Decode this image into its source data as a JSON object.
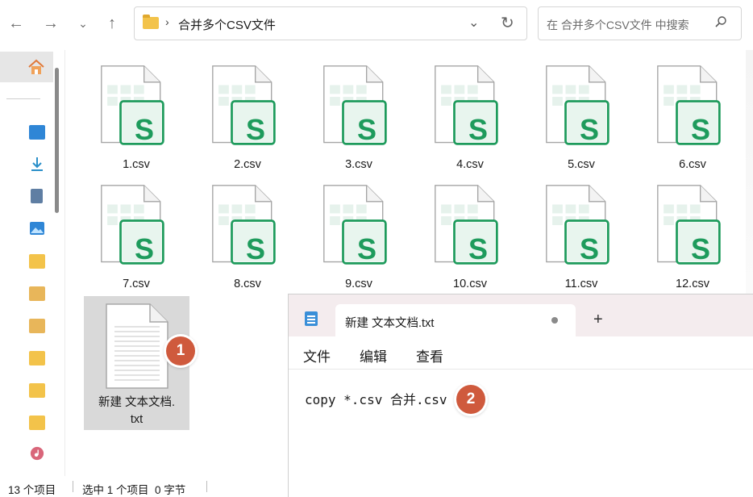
{
  "address": {
    "path": "合并多个CSV文件"
  },
  "search": {
    "placeholder": "在 合并多个CSV文件 中搜索"
  },
  "files": [
    {
      "name": "1.csv"
    },
    {
      "name": "2.csv"
    },
    {
      "name": "3.csv"
    },
    {
      "name": "4.csv"
    },
    {
      "name": "5.csv"
    },
    {
      "name": "6.csv"
    },
    {
      "name": "7.csv"
    },
    {
      "name": "8.csv"
    },
    {
      "name": "9.csv"
    },
    {
      "name": "10.csv"
    },
    {
      "name": "11.csv"
    },
    {
      "name": "12.csv"
    }
  ],
  "csv_icon_letter": "S",
  "selected_file": {
    "line1": "新建 文本文档.",
    "line2": "txt"
  },
  "badges": {
    "one": "1",
    "two": "2"
  },
  "notepad": {
    "tab_title": "新建 文本文档.txt",
    "plus": "+",
    "menu": {
      "file": "文件",
      "edit": "编辑",
      "view": "查看"
    },
    "content": "copy *.csv 合并.csv"
  },
  "status": {
    "count": "13 个项目",
    "selection": "选中 1 个项目  0 字节"
  },
  "colors": {
    "csv_green": "#1e9b5c",
    "badge": "#cf5a3d",
    "selection": "#d9d9d9"
  }
}
